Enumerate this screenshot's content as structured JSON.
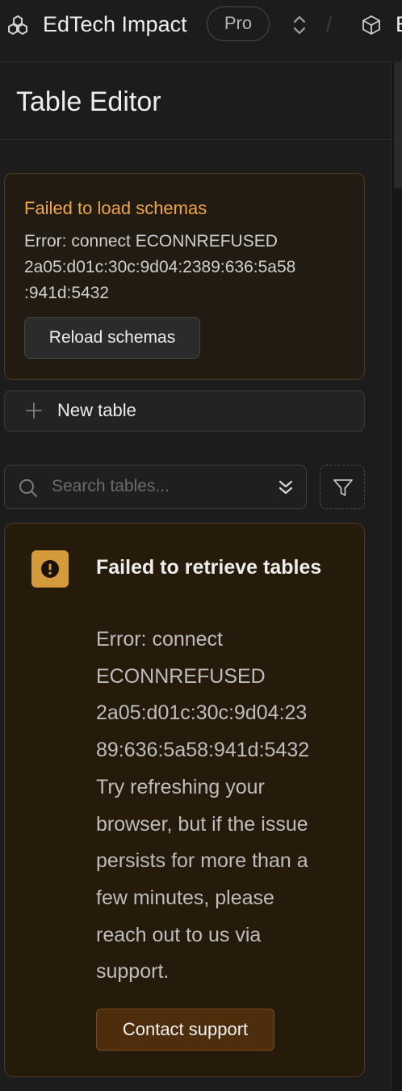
{
  "topbar": {
    "org_name": "EdTech Impact",
    "plan_badge": "Pro",
    "separator": "/",
    "project_initial": "E"
  },
  "panel": {
    "title": "Table Editor"
  },
  "schema_error": {
    "title": "Failed to load schemas",
    "lines": [
      "Error: connect ECONNREFUSED",
      "2a05:d01c:30c:9d04:2389:636:5a58",
      ":941d:5432"
    ],
    "reload_label": "Reload schemas"
  },
  "new_table": {
    "label": "New table"
  },
  "search": {
    "placeholder": "Search tables...",
    "value": ""
  },
  "tables_error": {
    "title": "Failed to retrieve tables",
    "lines": [
      "Error: connect",
      "ECONNREFUSED",
      "2a05:d01c:30c:9d04:23",
      "89:636:5a58:941d:5432",
      "Try refreshing your",
      "browser, but if the issue",
      "persists for more than a",
      "few minutes, please",
      "reach out to us via",
      "support."
    ],
    "contact_label": "Contact support"
  },
  "icons": {
    "logo": "org-logo-icon",
    "switcher": "chevron-up-down-icon",
    "project": "cube-icon",
    "new_table": "plus-icon",
    "search": "search-icon",
    "search_dropdown": "chevrons-down-icon",
    "filter": "filter-icon",
    "warning": "exclamation-icon"
  },
  "colors": {
    "background": "#1c1c1c",
    "warning_title": "#f0a54a",
    "warning_bg": "#261a0b",
    "warning_badge": "#d49a3b",
    "contact_button": "#4d2d0c"
  }
}
